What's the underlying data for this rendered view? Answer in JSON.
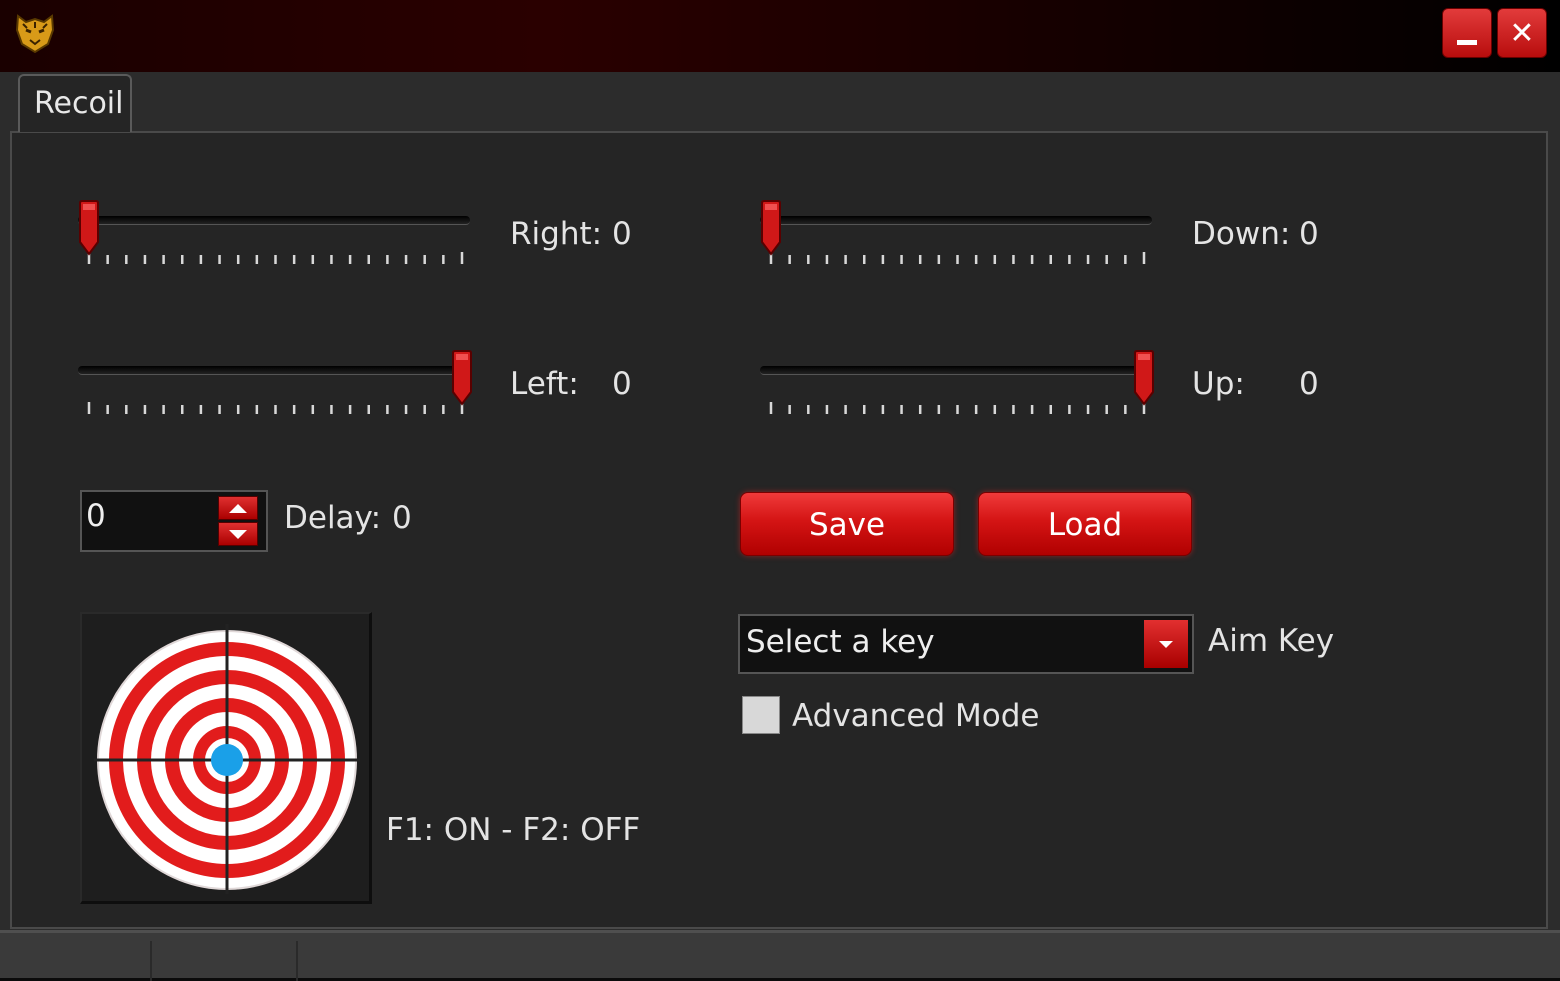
{
  "window": {
    "logo_icon": "tiger-logo-icon",
    "minimize_icon": "minimize-icon",
    "close_icon": "close-icon",
    "close_glyph": "✕",
    "accent": "#d41414"
  },
  "tabs": [
    {
      "label": "Recoil",
      "active": true
    }
  ],
  "sliders": {
    "right": {
      "label": "Right:",
      "value": "0",
      "thumb_fraction": 0.0
    },
    "down": {
      "label": "Down:",
      "value": "0",
      "thumb_fraction": 0.0
    },
    "left": {
      "label": "Left:",
      "value": "0",
      "thumb_fraction": 1.0
    },
    "up": {
      "label": "Up:",
      "value": "0",
      "thumb_fraction": 1.0
    }
  },
  "delay": {
    "input_value": "0",
    "label": "Delay:",
    "value": "0"
  },
  "buttons": {
    "save": "Save",
    "load": "Load"
  },
  "aim_key": {
    "selected": "Select a key",
    "label": "Aim Key"
  },
  "advanced_mode": {
    "label": "Advanced Mode",
    "checked": false
  },
  "hotkeys_text": "F1: ON - F2: OFF",
  "target_icon": "target-icon"
}
